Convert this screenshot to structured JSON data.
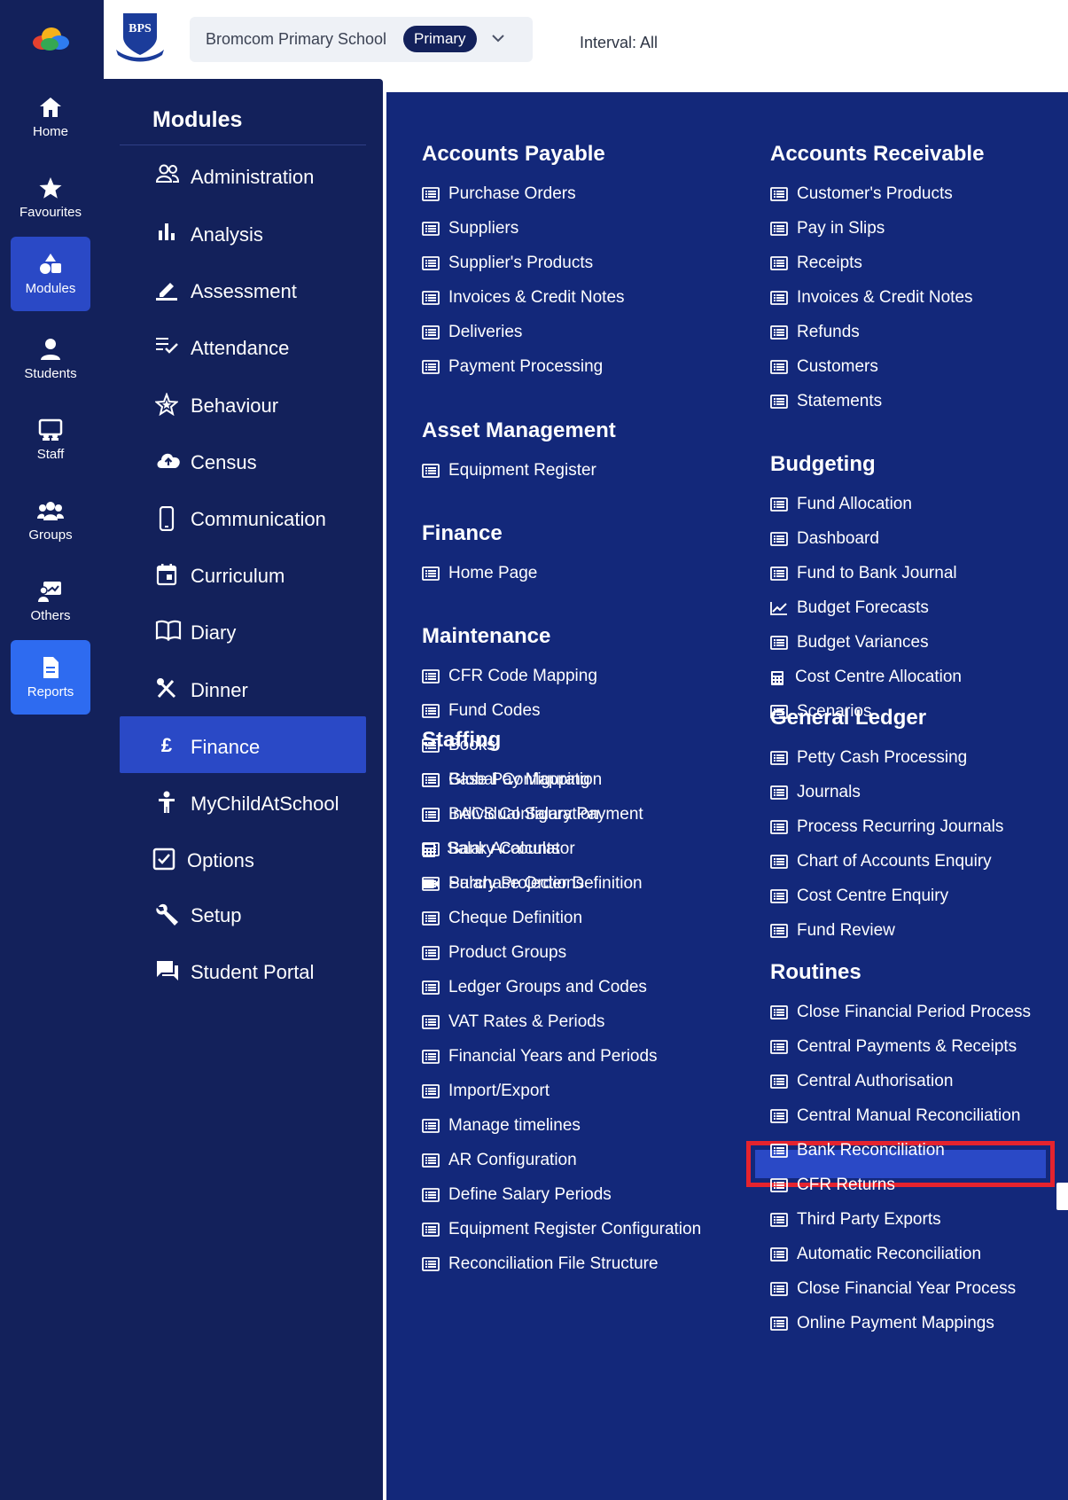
{
  "rail": {
    "items": [
      {
        "label": "Home",
        "icon": "home-icon"
      },
      {
        "label": "Favourites",
        "icon": "star-icon"
      },
      {
        "label": "Modules",
        "icon": "shapes-icon"
      },
      {
        "label": "Students",
        "icon": "person-icon"
      },
      {
        "label": "Staff",
        "icon": "staff-board-icon"
      },
      {
        "label": "Groups",
        "icon": "groups-icon"
      },
      {
        "label": "Others",
        "icon": "presentation-icon"
      },
      {
        "label": "Reports",
        "icon": "document-icon"
      }
    ]
  },
  "topbar": {
    "school_name": "Bromcom Primary School",
    "school_badge": "Primary",
    "interval": "Interval: All",
    "logo_text": "BPS"
  },
  "modules": {
    "title": "Modules",
    "items": [
      {
        "label": "Administration",
        "icon": "people-icon"
      },
      {
        "label": "Analysis",
        "icon": "bar-chart-icon"
      },
      {
        "label": "Assessment",
        "icon": "pen-icon"
      },
      {
        "label": "Attendance",
        "icon": "checklist-icon"
      },
      {
        "label": "Behaviour",
        "icon": "star-outline-icon"
      },
      {
        "label": "Census",
        "icon": "cloud-upload-icon"
      },
      {
        "label": "Communication",
        "icon": "phone-icon"
      },
      {
        "label": "Curriculum",
        "icon": "calendar-icon"
      },
      {
        "label": "Diary",
        "icon": "book-icon"
      },
      {
        "label": "Dinner",
        "icon": "cutlery-icon"
      },
      {
        "label": "Finance",
        "icon": "pound-icon",
        "glyph": "£"
      },
      {
        "label": "MyChildAtSchool",
        "icon": "child-icon"
      },
      {
        "label": "Options",
        "icon": "checkbox-icon"
      },
      {
        "label": "Setup",
        "icon": "wrench-icon"
      },
      {
        "label": "Student Portal",
        "icon": "chat-icon"
      }
    ]
  },
  "content": {
    "left": [
      {
        "title": "Accounts Payable",
        "links": [
          "Purchase Orders",
          "Suppliers",
          "Supplier's Products",
          "Invoices & Credit Notes",
          "Deliveries",
          "Payment Processing"
        ]
      },
      {
        "title": "Asset Management",
        "links": [
          "Equipment Register"
        ]
      },
      {
        "title": "Finance",
        "links": [
          "Home Page"
        ]
      },
      {
        "title": "Maintenance",
        "links": [
          "CFR Code Mapping",
          "Fund Codes",
          "Books",
          "Global Configuration",
          "BACS Configuration",
          "Bank Accounts",
          "Purchase Order Definition",
          "Cheque Definition",
          "Product Groups",
          "Ledger Groups and Codes",
          "VAT Rates & Periods",
          "Financial Years and Periods",
          "Import/Export",
          "Manage timelines",
          "AR Configuration",
          "Define Salary Periods",
          "Equipment Register Configuration",
          "Reconciliation File Structure"
        ]
      },
      {
        "title": "Staffing",
        "links": [
          "Base Pay Mapping",
          "Individual Salary Payment",
          "Salary Calculator",
          "Salary Projections"
        ]
      }
    ],
    "right": [
      {
        "title": "Accounts Receivable",
        "links": [
          "Customer's Products",
          "Pay in Slips",
          "Receipts",
          "Invoices & Credit Notes",
          "Refunds",
          "Customers",
          "Statements"
        ]
      },
      {
        "title": "Budgeting",
        "links": [
          "Fund Allocation",
          "Dashboard",
          "Fund to Bank Journal",
          "Budget Forecasts",
          "Budget Variances",
          "Cost Centre Allocation",
          "Scenarios"
        ]
      },
      {
        "title": "General Ledger",
        "links": [
          "Petty Cash Processing",
          "Journals",
          "Process Recurring Journals",
          "Chart of Accounts Enquiry",
          "Cost Centre Enquiry",
          "Fund Review"
        ]
      },
      {
        "title": "Routines",
        "links": [
          "Close Financial Period Process",
          "Central Payments & Receipts",
          "Central Authorisation",
          "Central Manual Reconciliation",
          "Bank Reconciliation",
          "CFR Returns",
          "Third Party Exports",
          "Automatic Reconciliation",
          "Close Financial Year Process",
          "Online Payment Mappings"
        ]
      }
    ]
  },
  "colors": {
    "rail_bg": "#13215b",
    "content_bg": "#13287a",
    "active": "#2a49c6",
    "reports_active": "#2e6bf0",
    "highlight_border": "#e5232e"
  }
}
